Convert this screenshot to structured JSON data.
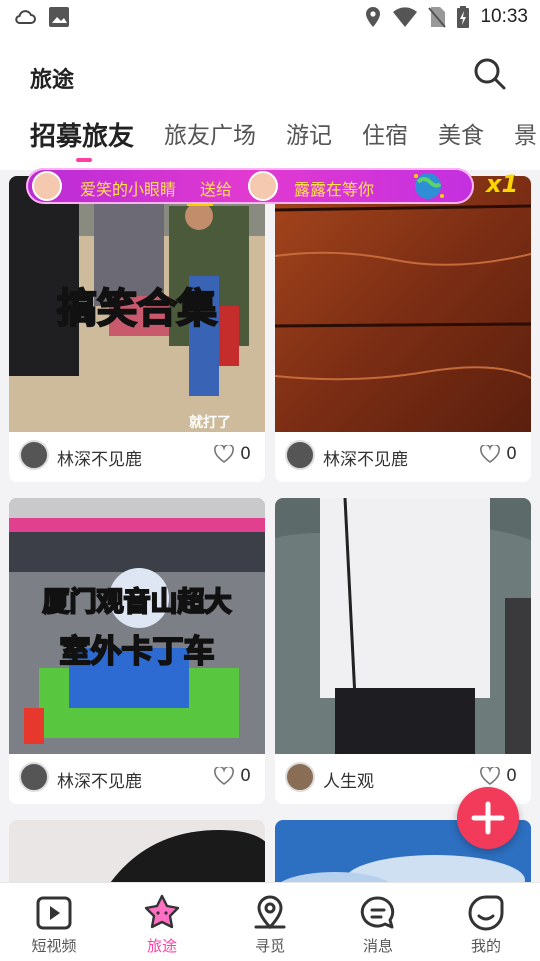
{
  "status_bar": {
    "time": "10:33",
    "left_icons": [
      "weather-cloud-icon",
      "gallery-icon"
    ],
    "right_icons": [
      "location-icon",
      "wifi-icon",
      "no-sim-icon",
      "battery-charging-icon"
    ]
  },
  "header": {
    "title": "旅途",
    "search_icon": "search-icon"
  },
  "tabs": [
    {
      "label": "招募旅友",
      "active": true
    },
    {
      "label": "旅友广场",
      "active": false
    },
    {
      "label": "游记",
      "active": false
    },
    {
      "label": "住宿",
      "active": false
    },
    {
      "label": "美食",
      "active": false
    },
    {
      "label": "景",
      "active": false
    }
  ],
  "gift_banner": {
    "sender": "爱笑的小眼睛",
    "action": "送给",
    "receiver": "露露在等你",
    "count": "x1"
  },
  "cards": [
    {
      "author": "林深不见鹿",
      "likes": "0",
      "overlay": "搞笑合集",
      "caption": "就打了"
    },
    {
      "author": "林深不见鹿",
      "likes": "0",
      "overlay": "",
      "caption": ""
    },
    {
      "author": "林深不见鹿",
      "likes": "0",
      "overlay_line1": "厦门观音山超大",
      "overlay_line2": "室外卡丁车"
    },
    {
      "author": "人生观",
      "likes": "0",
      "overlay": ""
    }
  ],
  "fab": {
    "icon": "plus-icon"
  },
  "bottom_nav": [
    {
      "label": "短视频",
      "icon": "video-play-icon",
      "active": false
    },
    {
      "label": "旅途",
      "icon": "star-icon",
      "active": true
    },
    {
      "label": "寻觅",
      "icon": "location-pin-icon",
      "active": false
    },
    {
      "label": "消息",
      "icon": "message-icon",
      "active": false
    },
    {
      "label": "我的",
      "icon": "profile-icon",
      "active": false
    }
  ],
  "colors": {
    "accent": "#ff3fa4",
    "fab": "#f23a5a",
    "gift_sender": "#ffe24a",
    "gift_receiver": "#ffe24a"
  }
}
